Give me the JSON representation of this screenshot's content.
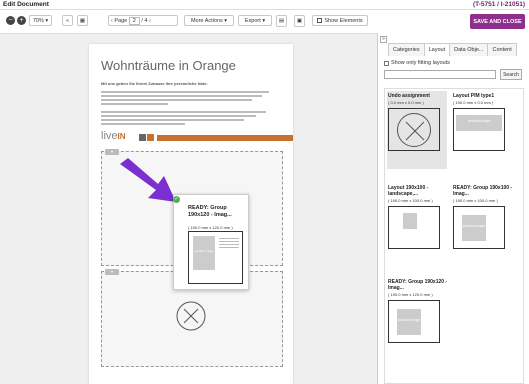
{
  "window": {
    "title": "Edit Document",
    "id": "(T-5751 / I-21051)"
  },
  "toolbar": {
    "zoom_minus": "−",
    "zoom_plus": "+",
    "zoom": "70%",
    "first_icon": "«",
    "page_label": "Page",
    "page_current": "2",
    "page_total": "/ 4",
    "next_icon": "›",
    "more_actions": "More Actions",
    "export": "Export",
    "show_elements": "Show Elements",
    "save_close": "SAVE AND CLOSE"
  },
  "document": {
    "title": "Wohnträume in Orange",
    "subtitle": "Mit uns geben Sie Ihrem Zuhause Ihre persönliche Note.",
    "logo_text": "live",
    "logo_accent": "IN",
    "accent_color": "#c8702e"
  },
  "drag_preview": {
    "title": "READY: Group 190x120 - Imag...",
    "size": "( 190.0 mm x 120.0 mm )",
    "image_label": "product image"
  },
  "panel": {
    "collapse_icon": "»",
    "tabs": [
      "Categories",
      "Layout",
      "Data Obje...",
      "Content"
    ],
    "active_tab": "Layout",
    "filter_label": "Show only fitting layouts",
    "search_button": "Search",
    "layouts": [
      {
        "title": "Undo assignment",
        "size": "( 0.0 mm x 0.0 mm )"
      },
      {
        "title": "Layout PIM type1",
        "size": "( 190.0 mm x 0.0 mm )",
        "image": "product image"
      },
      {
        "title": "Layout 190x100 - landscape,...",
        "size": "( 190.0 mm x 100.0 mm )"
      },
      {
        "title": "READY: Group 190x100 - Imag...",
        "size": "( 190.0 mm x 100.0 mm )",
        "image": "product image"
      },
      {
        "title": "READY: Group 190x120 - Imag...",
        "size": "( 190.0 mm x 120.0 mm )",
        "image": "product image"
      }
    ]
  },
  "colors": {
    "brand": "#8e2f8e",
    "arrow": "#7b2fd1",
    "ready": "#4caf50"
  }
}
